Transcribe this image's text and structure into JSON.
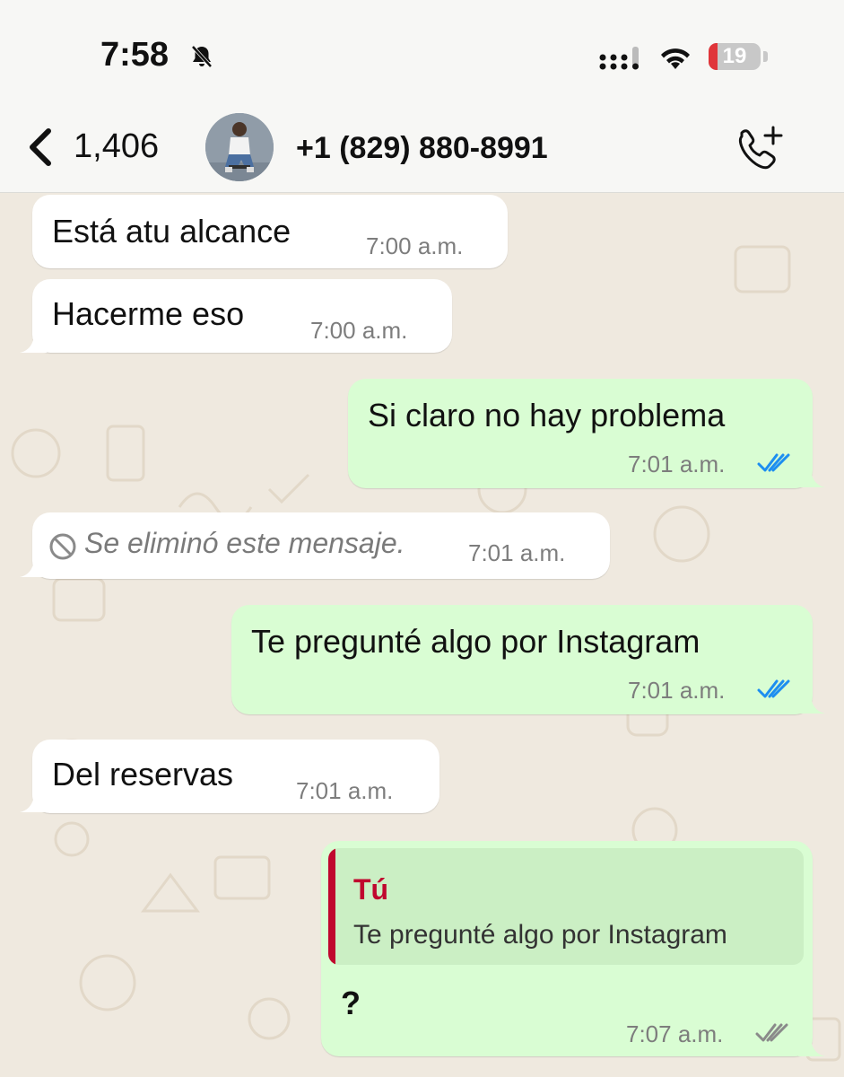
{
  "status_bar": {
    "time": "7:58",
    "battery_level": "19",
    "icons": [
      "bell-slash-icon",
      "signal-icon",
      "wifi-icon",
      "battery-icon"
    ]
  },
  "header": {
    "back_count": "1,406",
    "contact": "+1 (829) 880-8991",
    "icons": [
      "chevron-left-icon",
      "avatar",
      "add-call-icon"
    ]
  },
  "messages": [
    {
      "direction": "in",
      "text": "Está atu alcance",
      "time": "7:00 a.m."
    },
    {
      "direction": "in",
      "text": "Hacerme eso",
      "time": "7:00 a.m."
    },
    {
      "direction": "out",
      "text": "Si claro no hay problema",
      "time": "7:01 a.m.",
      "status": "read"
    },
    {
      "direction": "in",
      "deleted": true,
      "text": "Se eliminó este mensaje.",
      "time": "7:01 a.m."
    },
    {
      "direction": "out",
      "text": "Te pregunté algo por Instagram",
      "time": "7:01 a.m.",
      "status": "read"
    },
    {
      "direction": "in",
      "text": "Del reservas",
      "time": "7:01 a.m."
    },
    {
      "direction": "out",
      "reply_to": {
        "author": "Tú",
        "text": "Te pregunté algo por Instagram"
      },
      "text": "?",
      "time": "7:07 a.m.",
      "status": "delivered"
    }
  ],
  "colors": {
    "outgoing_bubble": "#d9fdd3",
    "incoming_bubble": "#ffffff",
    "read_ticks": "#1d8ef0",
    "delivered_ticks": "#8a8a8a",
    "quote_author": "#c0072e"
  }
}
